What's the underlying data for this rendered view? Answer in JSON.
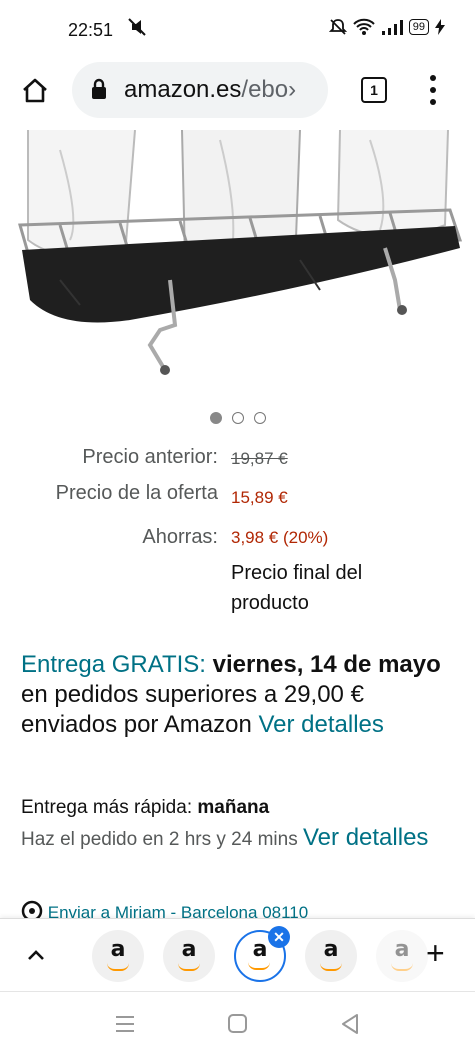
{
  "status": {
    "time": "22:51",
    "battery": "99"
  },
  "browser": {
    "url_host": "amazon.es",
    "url_path": "/ebo›",
    "tab_count": "1"
  },
  "product": {
    "image_dots": 3,
    "prices": {
      "previous_label": "Precio anterior:",
      "previous_value": "19,87 €",
      "deal_label": "Precio de la oferta",
      "deal_value": "15,89 €",
      "savings_label": "Ahorras:",
      "savings_value": "3,98 € (20%)",
      "final_note": "Precio final del producto"
    }
  },
  "delivery": {
    "free_label": "Entrega GRATIS:",
    "date": "viernes, 14 de mayo",
    "condition": " en pedidos superiores a 29,00 € enviados por Amazon ",
    "details_link": "Ver detalles",
    "fastest_label": "Entrega más rápida: ",
    "fastest_day": "mañana",
    "order_within": "Haz el pedido en 2 hrs y 24 mins ",
    "fastest_details_link": "Ver detalles",
    "ship_to": "Enviar a Miriam - Barcelona 08110"
  },
  "tab_strip": {
    "tab_letter": "a"
  },
  "colors": {
    "link": "#007185",
    "price": "#b12704",
    "accent": "#1a73e8"
  }
}
